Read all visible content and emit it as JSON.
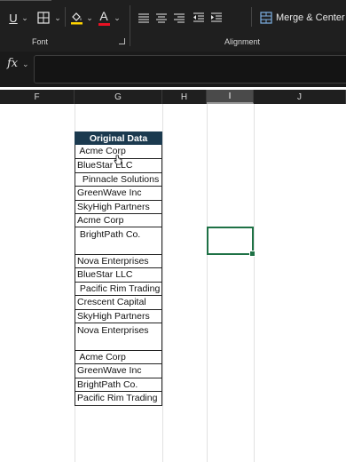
{
  "ribbon": {
    "underline_label": "U",
    "font_color_label": "A",
    "font_group_label": "Font",
    "alignment_group_label": "Alignment",
    "merge_center_label": "Merge & Center"
  },
  "formula_bar": {
    "fx_label": "fx",
    "value": ""
  },
  "columns": [
    "F",
    "G",
    "H",
    "I",
    "J"
  ],
  "table": {
    "header": "Original Data",
    "rows": [
      " Acme Corp",
      "BlueStar LLC",
      "  Pinnacle Solutions",
      "GreenWave Inc",
      "SkyHigh Partners",
      "Acme Corp",
      " BrightPath Co.",
      "Nova Enterprises",
      "BlueStar LLC",
      " Pacific Rim Trading",
      "Crescent Capital",
      "SkyHigh Partners",
      "Nova Enterprises",
      " Acme Corp",
      "GreenWave Inc",
      "BrightPath Co.",
      "Pacific Rim Trading"
    ]
  },
  "colors": {
    "header_fill": "#1b3a4f",
    "active_cell_border": "#1e7145",
    "ribbon_bg": "#1f1f1f"
  },
  "icons": [
    "underline-icon",
    "borders-icon",
    "fill-color-icon",
    "font-color-icon",
    "align-top-icon",
    "align-middle-icon",
    "align-bottom-icon",
    "align-left-icon",
    "align-center-icon",
    "align-right-icon",
    "decrease-indent-icon",
    "increase-indent-icon",
    "merge-center-icon",
    "dialog-launcher-icon",
    "mouse-cursor-icon"
  ]
}
